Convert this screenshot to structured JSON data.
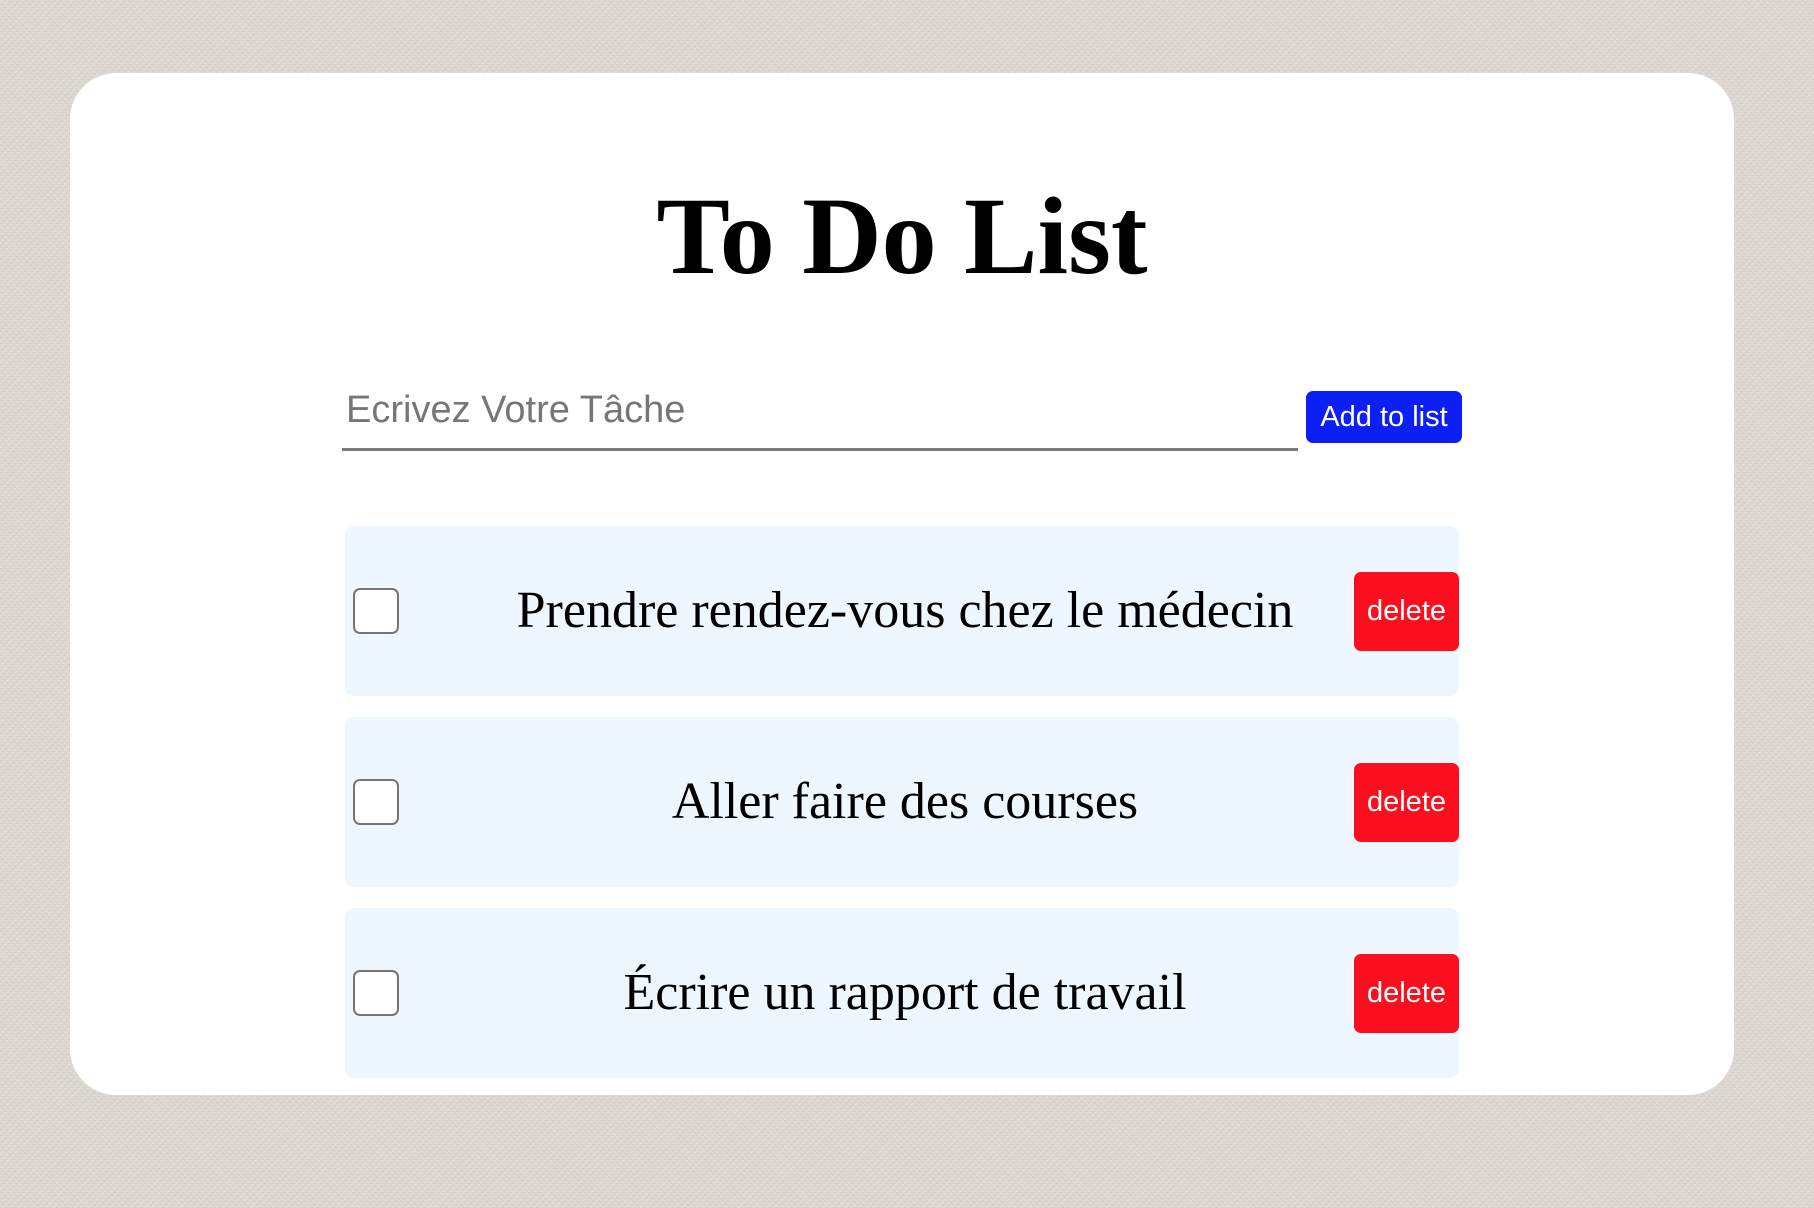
{
  "title": "To Do List",
  "input": {
    "value": "",
    "placeholder": "Ecrivez Votre Tâche"
  },
  "add_button_label": "Add to list",
  "tasks": [
    {
      "text": "Prendre rendez-vous chez le médecin",
      "checked": false,
      "delete_label": "delete"
    },
    {
      "text": "Aller faire des courses",
      "checked": false,
      "delete_label": "delete"
    },
    {
      "text": "Écrire un rapport de travail",
      "checked": false,
      "delete_label": "delete"
    }
  ],
  "colors": {
    "add_button": "#0b1ff6",
    "delete_button": "#fd0e1f",
    "task_background": "#eef6fe",
    "card_background": "#ffffff"
  }
}
